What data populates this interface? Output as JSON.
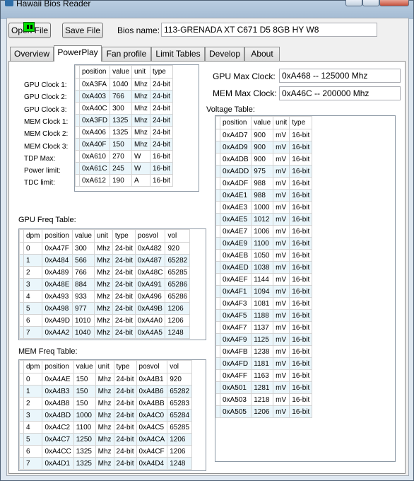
{
  "window": {
    "title": "Hawaii Bios Reader"
  },
  "toolbar": {
    "open_label": "Open File",
    "save_label": "Save File",
    "bios_label": "Bios name:",
    "bios_value": "113-GRENADA XT C671 D5 8GB HY W8"
  },
  "tabs": [
    {
      "label": "Overview"
    },
    {
      "label": "PowerPlay"
    },
    {
      "label": "Fan profile"
    },
    {
      "label": "Limit Tables"
    },
    {
      "label": "Develop"
    },
    {
      "label": "About"
    }
  ],
  "powerplay": {
    "headers": [
      "position",
      "value",
      "unit",
      "type"
    ],
    "rows": [
      {
        "label": "GPU Clock 1:",
        "position": "0xA3FA",
        "value": "1040",
        "unit": "Mhz",
        "type": "24-bit"
      },
      {
        "label": "GPU Clock 2:",
        "position": "0xA403",
        "value": "766",
        "unit": "Mhz",
        "type": "24-bit"
      },
      {
        "label": "GPU Clock 3:",
        "position": "0xA40C",
        "value": "300",
        "unit": "Mhz",
        "type": "24-bit"
      },
      {
        "label": "MEM Clock 1:",
        "position": "0xA3FD",
        "value": "1325",
        "unit": "Mhz",
        "type": "24-bit"
      },
      {
        "label": "MEM Clock 2:",
        "position": "0xA406",
        "value": "1325",
        "unit": "Mhz",
        "type": "24-bit"
      },
      {
        "label": "MEM Clock 3:",
        "position": "0xA40F",
        "value": "150",
        "unit": "Mhz",
        "type": "24-bit"
      },
      {
        "label": "TDP Max:",
        "position": "0xA610",
        "value": "270",
        "unit": "W",
        "type": "16-bit"
      },
      {
        "label": "Power limit:",
        "position": "0xA61C",
        "value": "245",
        "unit": "W",
        "type": "16-bit"
      },
      {
        "label": "TDC limit:",
        "position": "0xA612",
        "value": "190",
        "unit": "A",
        "type": "16-bit"
      }
    ],
    "gpu_max_label": "GPU Max Clock:",
    "gpu_max_value": "0xA468 -- 125000 Mhz",
    "mem_max_label": "MEM Max Clock:",
    "mem_max_value": "0xA46C -- 200000 Mhz"
  },
  "gpu_freq": {
    "title": "GPU Freq Table:",
    "headers": [
      "dpm",
      "position",
      "value",
      "unit",
      "type",
      "posvol",
      "vol"
    ],
    "rows": [
      [
        "0",
        "0xA47F",
        "300",
        "Mhz",
        "24-bit",
        "0xA482",
        "920"
      ],
      [
        "1",
        "0xA484",
        "566",
        "Mhz",
        "24-bit",
        "0xA487",
        "65282"
      ],
      [
        "2",
        "0xA489",
        "766",
        "Mhz",
        "24-bit",
        "0xA48C",
        "65285"
      ],
      [
        "3",
        "0xA48E",
        "884",
        "Mhz",
        "24-bit",
        "0xA491",
        "65286"
      ],
      [
        "4",
        "0xA493",
        "933",
        "Mhz",
        "24-bit",
        "0xA496",
        "65286"
      ],
      [
        "5",
        "0xA498",
        "977",
        "Mhz",
        "24-bit",
        "0xA49B",
        "1206"
      ],
      [
        "6",
        "0xA49D",
        "1010",
        "Mhz",
        "24-bit",
        "0xA4A0",
        "1206"
      ],
      [
        "7",
        "0xA4A2",
        "1040",
        "Mhz",
        "24-bit",
        "0xA4A5",
        "1248"
      ]
    ]
  },
  "mem_freq": {
    "title": "MEM Freq Table:",
    "headers": [
      "dpm",
      "position",
      "value",
      "unit",
      "type",
      "posvol",
      "vol"
    ],
    "rows": [
      [
        "0",
        "0xA4AE",
        "150",
        "Mhz",
        "24-bit",
        "0xA4B1",
        "920"
      ],
      [
        "1",
        "0xA4B3",
        "150",
        "Mhz",
        "24-bit",
        "0xA4B6",
        "65282"
      ],
      [
        "2",
        "0xA4B8",
        "150",
        "Mhz",
        "24-bit",
        "0xA4BB",
        "65283"
      ],
      [
        "3",
        "0xA4BD",
        "1000",
        "Mhz",
        "24-bit",
        "0xA4C0",
        "65284"
      ],
      [
        "4",
        "0xA4C2",
        "1100",
        "Mhz",
        "24-bit",
        "0xA4C5",
        "65285"
      ],
      [
        "5",
        "0xA4C7",
        "1250",
        "Mhz",
        "24-bit",
        "0xA4CA",
        "1206"
      ],
      [
        "6",
        "0xA4CC",
        "1325",
        "Mhz",
        "24-bit",
        "0xA4CF",
        "1206"
      ],
      [
        "7",
        "0xA4D1",
        "1325",
        "Mhz",
        "24-bit",
        "0xA4D4",
        "1248"
      ]
    ]
  },
  "voltage": {
    "title": "Voltage Table:",
    "headers": [
      "position",
      "value",
      "unit",
      "type"
    ],
    "rows": [
      [
        "0xA4D7",
        "900",
        "mV",
        "16-bit"
      ],
      [
        "0xA4D9",
        "900",
        "mV",
        "16-bit"
      ],
      [
        "0xA4DB",
        "900",
        "mV",
        "16-bit"
      ],
      [
        "0xA4DD",
        "975",
        "mV",
        "16-bit"
      ],
      [
        "0xA4DF",
        "988",
        "mV",
        "16-bit"
      ],
      [
        "0xA4E1",
        "988",
        "mV",
        "16-bit"
      ],
      [
        "0xA4E3",
        "1000",
        "mV",
        "16-bit"
      ],
      [
        "0xA4E5",
        "1012",
        "mV",
        "16-bit"
      ],
      [
        "0xA4E7",
        "1006",
        "mV",
        "16-bit"
      ],
      [
        "0xA4E9",
        "1100",
        "mV",
        "16-bit"
      ],
      [
        "0xA4EB",
        "1050",
        "mV",
        "16-bit"
      ],
      [
        "0xA4ED",
        "1038",
        "mV",
        "16-bit"
      ],
      [
        "0xA4EF",
        "1144",
        "mV",
        "16-bit"
      ],
      [
        "0xA4F1",
        "1094",
        "mV",
        "16-bit"
      ],
      [
        "0xA4F3",
        "1081",
        "mV",
        "16-bit"
      ],
      [
        "0xA4F5",
        "1188",
        "mV",
        "16-bit"
      ],
      [
        "0xA4F7",
        "1137",
        "mV",
        "16-bit"
      ],
      [
        "0xA4F9",
        "1125",
        "mV",
        "16-bit"
      ],
      [
        "0xA4FB",
        "1238",
        "mV",
        "16-bit"
      ],
      [
        "0xA4FD",
        "1181",
        "mV",
        "16-bit"
      ],
      [
        "0xA4FF",
        "1163",
        "mV",
        "16-bit"
      ],
      [
        "0xA501",
        "1281",
        "mV",
        "16-bit"
      ],
      [
        "0xA503",
        "1218",
        "mV",
        "16-bit"
      ],
      [
        "0xA505",
        "1206",
        "mV",
        "16-bit"
      ]
    ]
  }
}
